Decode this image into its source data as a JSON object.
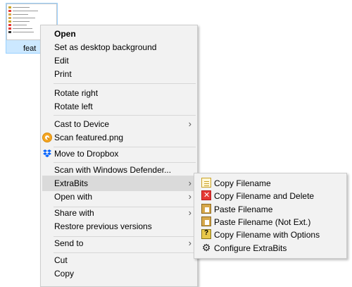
{
  "desktop": {
    "file_label": "feat",
    "thumbnail_lines": [
      "Copy Filename",
      "Copy Filename and Delete",
      "Paste Filename",
      "Paste Filename (Not Ext.)",
      "Copy Filename",
      "Select Folder",
      "Delete Empty F...",
      "Configure Extra..."
    ]
  },
  "context_menu": {
    "items": [
      {
        "label": "Open"
      },
      {
        "label": "Set as desktop background"
      },
      {
        "label": "Edit"
      },
      {
        "label": "Print"
      },
      {
        "label": "Rotate right"
      },
      {
        "label": "Rotate left"
      },
      {
        "label": "Cast to Device"
      },
      {
        "label": "Scan featured.png"
      },
      {
        "label": "Move to Dropbox"
      },
      {
        "label": "Scan with Windows Defender..."
      },
      {
        "label": "ExtraBits"
      },
      {
        "label": "Open with"
      },
      {
        "label": "Share with"
      },
      {
        "label": "Restore previous versions"
      },
      {
        "label": "Send to"
      },
      {
        "label": "Cut"
      },
      {
        "label": "Copy"
      }
    ],
    "chevron": "›"
  },
  "submenu": {
    "items": [
      {
        "label": "Copy Filename",
        "icon": "document-icon"
      },
      {
        "label": "Copy Filename and Delete",
        "icon": "delete-icon"
      },
      {
        "label": "Paste Filename",
        "icon": "paste-icon"
      },
      {
        "label": "Paste Filename (Not Ext.)",
        "icon": "paste-icon"
      },
      {
        "label": "Copy Filename with Options",
        "icon": "options-icon"
      },
      {
        "label": "Configure ExtraBits",
        "icon": "gear-icon"
      }
    ]
  },
  "colors": {
    "menu_bg": "#f2f2f2",
    "hover_bg": "#dadada",
    "selection_bg": "#cce8ff",
    "border": "#cccccc"
  }
}
